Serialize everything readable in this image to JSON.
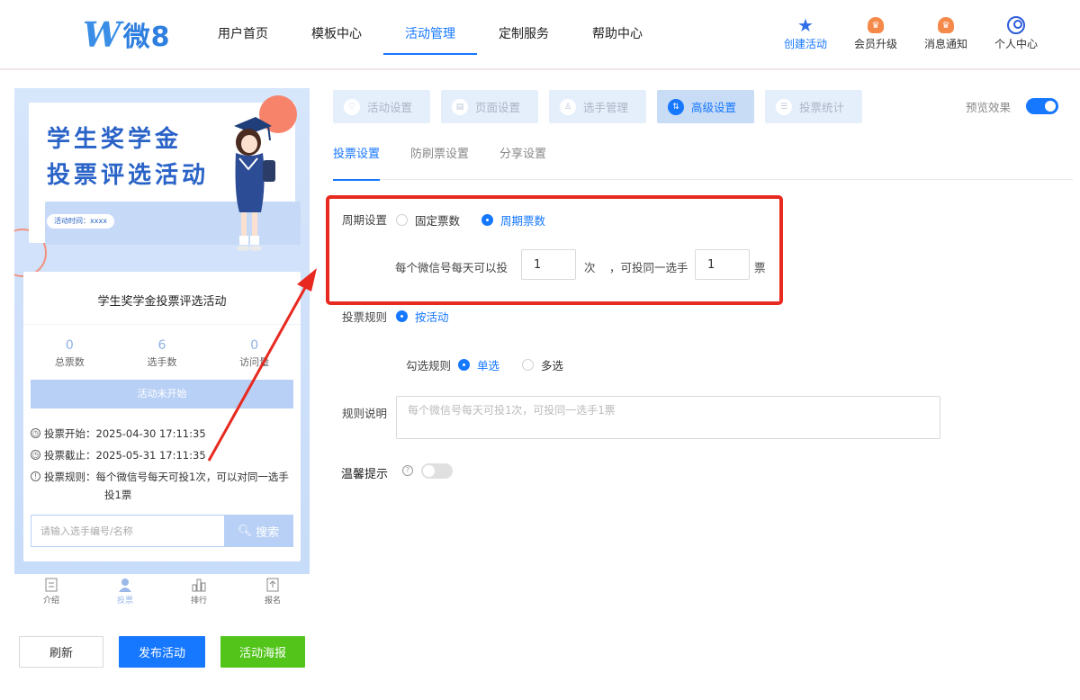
{
  "logo": {
    "text": "微8"
  },
  "nav": [
    "用户首页",
    "模板中心",
    "活动管理",
    "定制服务",
    "帮助中心"
  ],
  "tools": {
    "create": "创建活动",
    "upgrade": "会员升级",
    "notice": "消息通知",
    "profile": "个人中心"
  },
  "preview": {
    "banner_line1": "学生奖学金",
    "banner_line2": "投票评选活动",
    "banner_time": "活动时间：xxxx",
    "card_title": "学生奖学金投票评选活动",
    "stats": [
      {
        "num": "0",
        "label": "总票数"
      },
      {
        "num": "6",
        "label": "选手数"
      },
      {
        "num": "0",
        "label": "访问量"
      }
    ],
    "status": "活动未开始",
    "start": "投票开始：2025-04-30 17:11:35",
    "end": "投票截止：2025-05-31 17:11:35",
    "rule_line1": "投票规则：每个微信号每天可投1次，可以对同一选手",
    "rule_line2": "投1票",
    "search_placeholder": "请输入选手编号/名称",
    "search_btn": "搜索",
    "bottom_nav": [
      "介绍",
      "投票",
      "排行",
      "报名"
    ]
  },
  "buttons": {
    "refresh": "刷新",
    "publish": "发布活动",
    "poster": "活动海报"
  },
  "steps": [
    "活动设置",
    "页面设置",
    "选手管理",
    "高级设置",
    "投票统计"
  ],
  "preview_toggle": "预览效果",
  "subtabs": [
    "投票设置",
    "防刷票设置",
    "分享设置"
  ],
  "form": {
    "period_label": "周期设置",
    "period_fixed": "固定票数",
    "period_cycle": "周期票数",
    "per_day_text": "每个微信号每天可以投",
    "per_day_value": "1",
    "times_unit": "次",
    "same_player_text": "，可投同一选手",
    "same_player_value": "1",
    "votes_unit": "票",
    "rule_label": "投票规则",
    "rule_by_activity": "按活动",
    "select_label": "勾选规则",
    "single": "单选",
    "multi": "多选",
    "desc_label": "规则说明",
    "desc_placeholder": "每个微信号每天可投1次，可投同一选手1票",
    "tip_label": "温馨提示"
  }
}
